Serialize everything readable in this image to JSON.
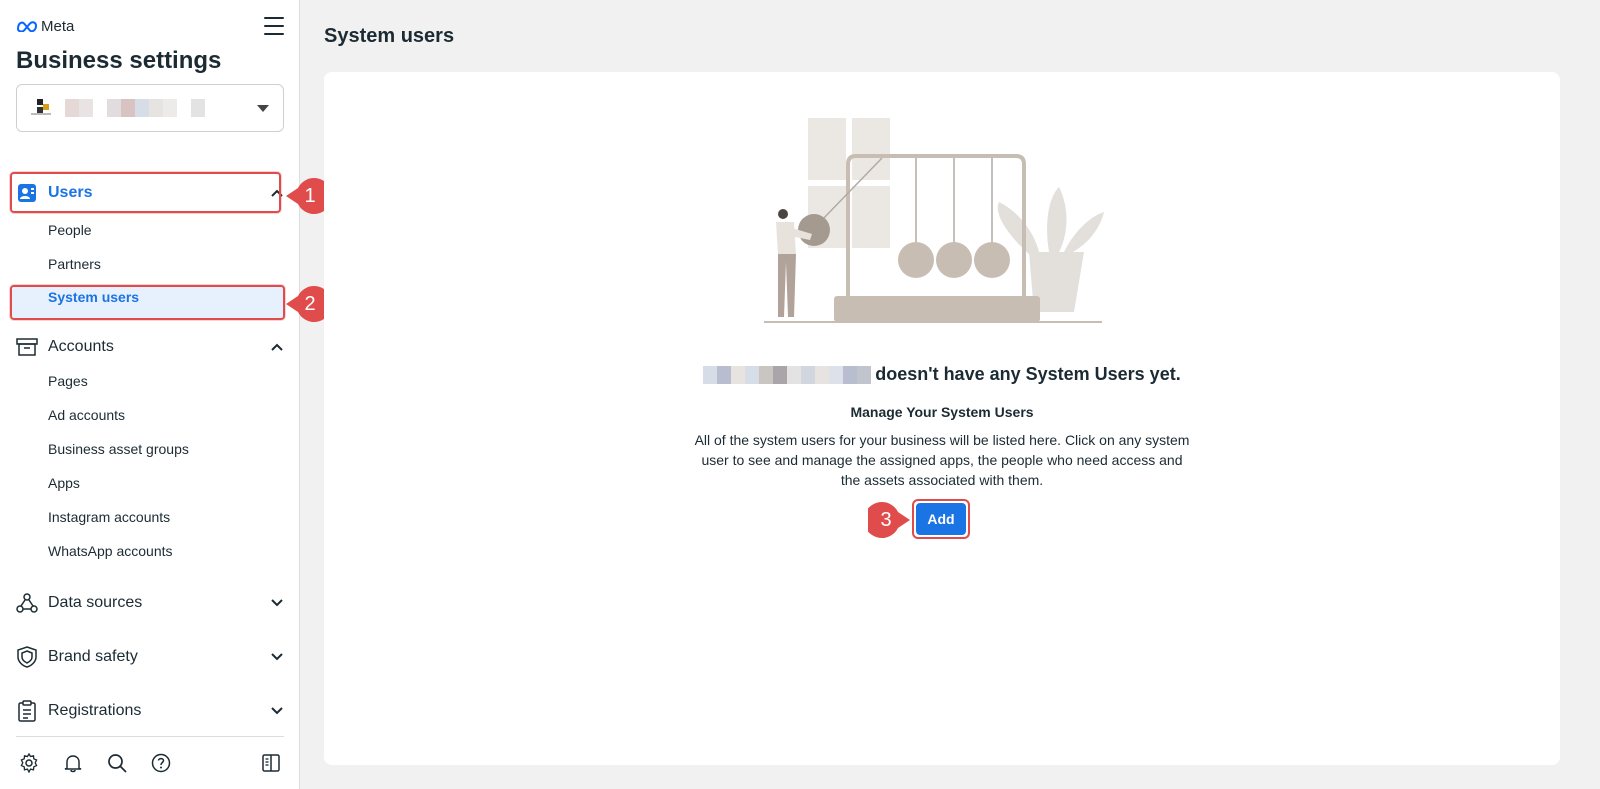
{
  "app": {
    "brand": "Meta",
    "title": "Business settings"
  },
  "business_selector": {
    "avatar_colors": [
      "#222222",
      "#d4a017"
    ],
    "blur_colors": [
      "#e7d8d8",
      "#e9e3e3",
      "#ffffff",
      "#e3dcdf",
      "#d9c2c2",
      "#d7dde6",
      "#e6e3e1",
      "#ecebe9"
    ]
  },
  "nav": {
    "users": {
      "label": "Users",
      "items": [
        {
          "label": "People"
        },
        {
          "label": "Partners"
        },
        {
          "label": "System users"
        }
      ]
    },
    "accounts": {
      "label": "Accounts",
      "items": [
        {
          "label": "Pages"
        },
        {
          "label": "Ad accounts"
        },
        {
          "label": "Business asset groups"
        },
        {
          "label": "Apps"
        },
        {
          "label": "Instagram accounts"
        },
        {
          "label": "WhatsApp accounts"
        }
      ]
    },
    "data_sources": {
      "label": "Data sources"
    },
    "brand_safety": {
      "label": "Brand safety"
    },
    "registrations": {
      "label": "Registrations"
    }
  },
  "footer_icons": [
    "gear-icon",
    "bell-icon",
    "search-icon",
    "help-icon",
    "panel-toggle-icon"
  ],
  "annotations": {
    "step1": "1",
    "step2": "2",
    "step3": "3",
    "color": "#e04c4c"
  },
  "main": {
    "page_title": "System users",
    "empty_state": {
      "title_suffix": "doesn't have any System Users yet.",
      "subtitle": "Manage Your System Users",
      "description": "All of the system users for your business will be listed here. Click on any system user to see and manage the assigned apps, the people who need access and the assets associated with them.",
      "add_label": "Add"
    }
  },
  "colors": {
    "accent": "#1b74e4",
    "text": "#1c2b33",
    "highlight": "#e04c4c"
  }
}
